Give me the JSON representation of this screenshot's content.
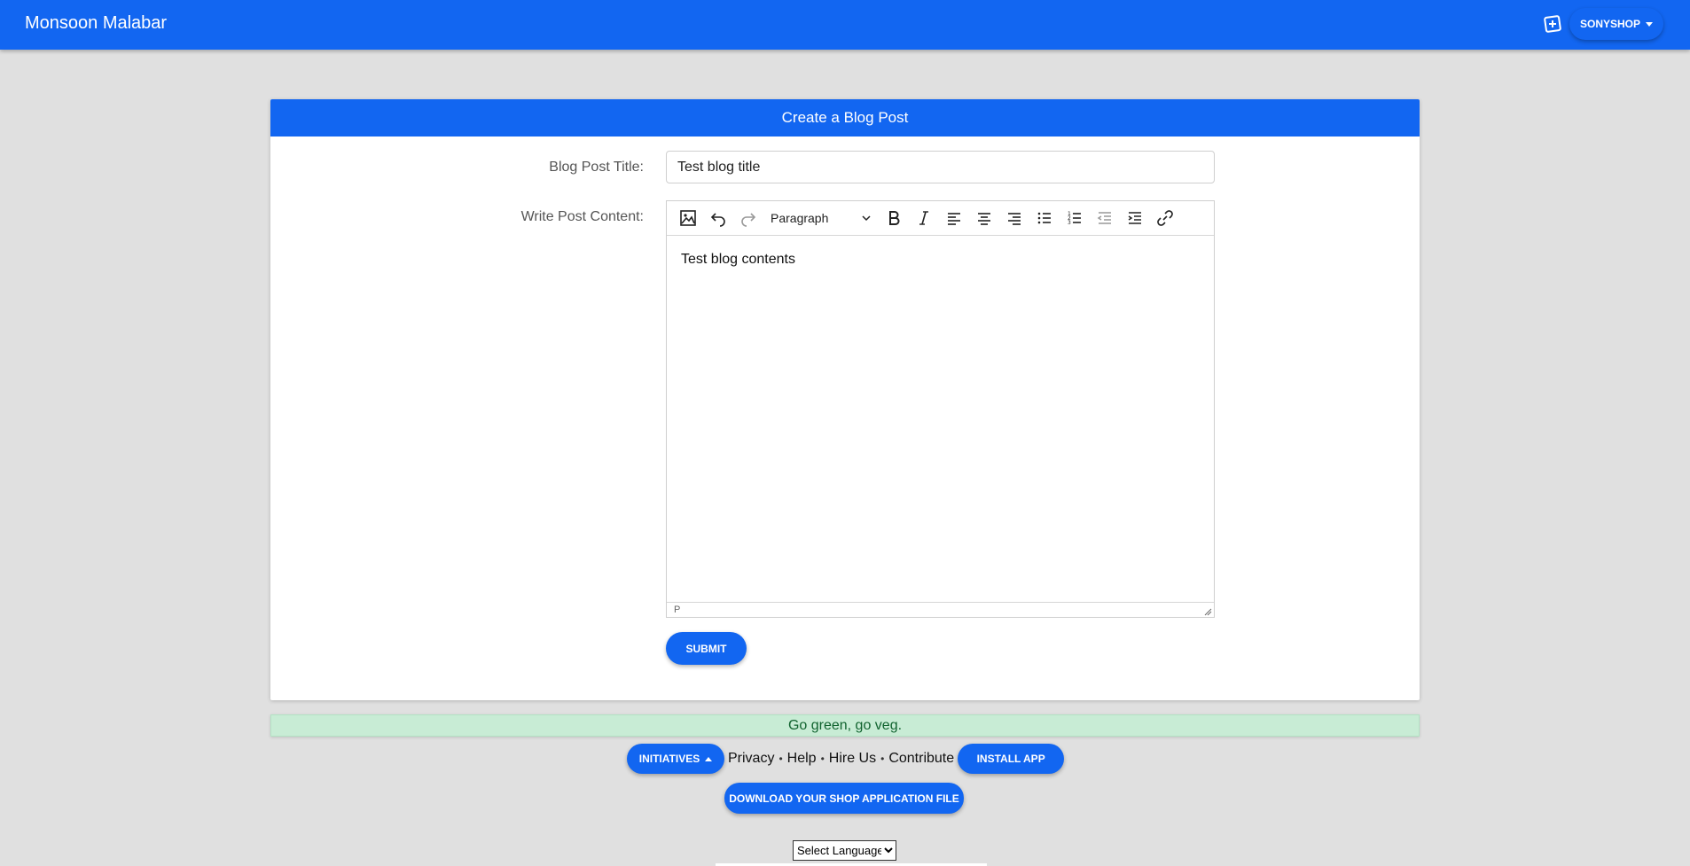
{
  "header": {
    "brand": "Monsoon Malabar",
    "user_menu_label": "SONYSHOP"
  },
  "form": {
    "heading": "Create a Blog Post",
    "title_label": "Blog Post Title:",
    "title_value": "Test blog title",
    "content_label": "Write Post Content:",
    "editor": {
      "block_format": "Paragraph",
      "content": "Test blog contents",
      "status_path": "P",
      "toolbar_icons": [
        "image-icon",
        "undo-icon",
        "redo-icon",
        "bold-icon",
        "italic-icon",
        "align-left-icon",
        "align-center-icon",
        "align-right-icon",
        "bullet-list-icon",
        "numbered-list-icon",
        "outdent-icon",
        "indent-icon",
        "link-icon"
      ]
    },
    "submit_label": "SUBMIT"
  },
  "banner": {
    "text": "Go green, go veg."
  },
  "footer": {
    "initiatives_label": "INITIATIVES",
    "links": [
      "Privacy",
      "Help",
      "Hire Us",
      "Contribute"
    ],
    "install_label": "INSTALL APP",
    "download_label": "DOWNLOAD YOUR SHOP APPLICATION FILE",
    "language_select": "Select Language"
  },
  "colors": {
    "primary": "#1266f1",
    "page_bg": "#e0e0e0",
    "banner_bg": "#c8ecd5",
    "banner_text": "#11632f"
  }
}
